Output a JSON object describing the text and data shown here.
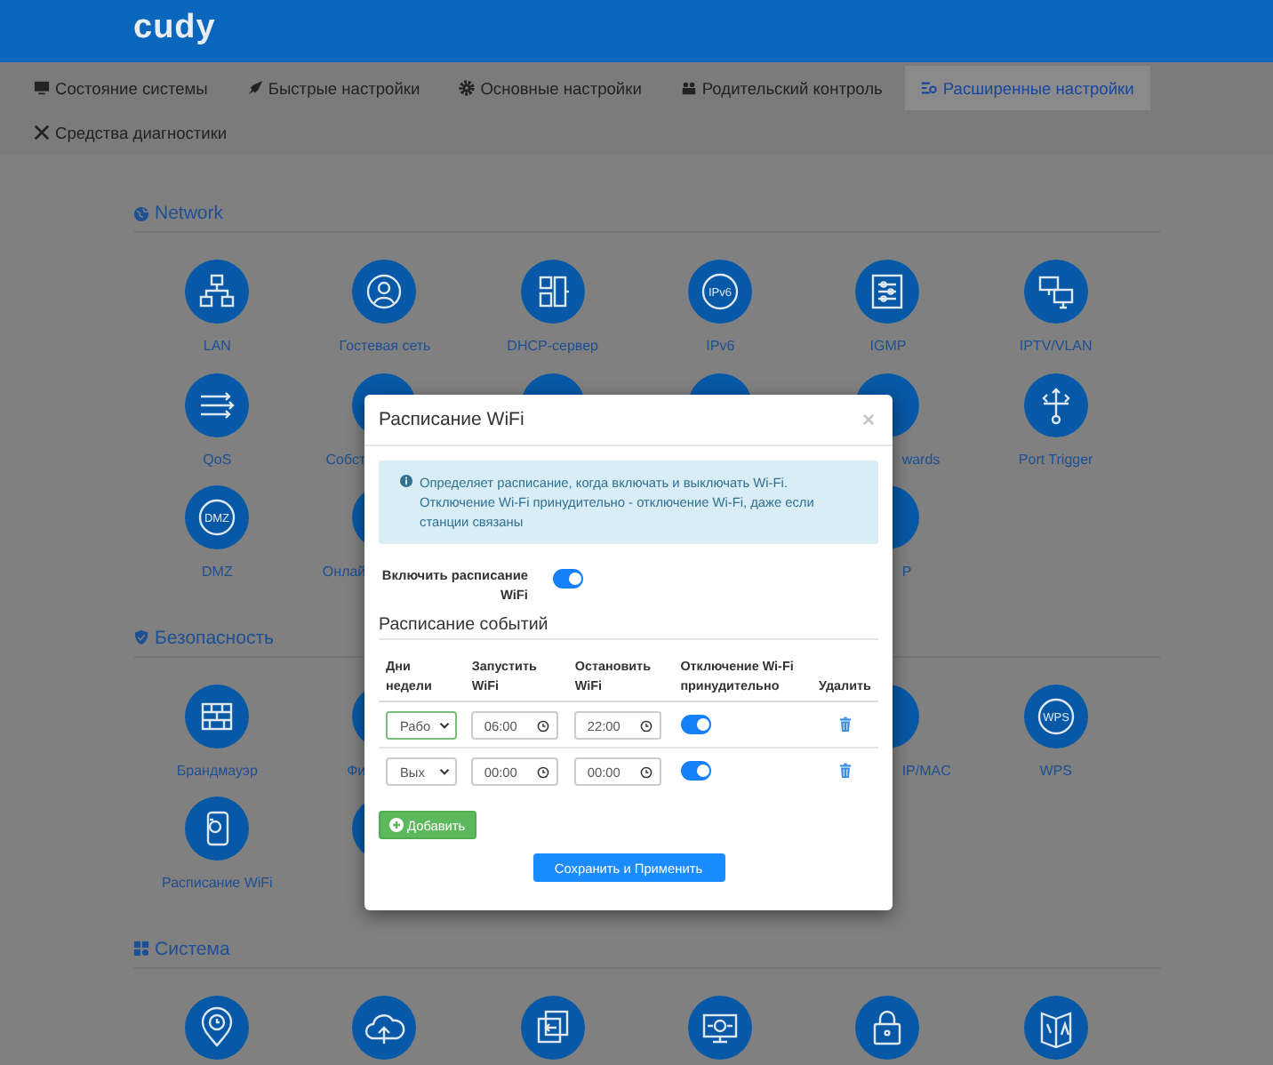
{
  "header": {
    "logo": "cudy"
  },
  "nav": [
    {
      "label": "Состояние системы",
      "selected": false
    },
    {
      "label": "Быстрые настройки",
      "selected": false
    },
    {
      "label": "Основные настройки",
      "selected": false
    },
    {
      "label": "Родительский контроль",
      "selected": false
    },
    {
      "label": "Расширенные настройки",
      "selected": true
    },
    {
      "label": "Средства диагностики",
      "selected": false
    }
  ],
  "sections": [
    {
      "title": "Network",
      "items": [
        {
          "kind": "full",
          "label": "LAN"
        },
        {
          "kind": "full",
          "label": "Гостевая сеть"
        },
        {
          "kind": "full",
          "label": "DHCP-сервер"
        },
        {
          "kind": "full",
          "label": "IPv6",
          "icon_text": "IPv6"
        },
        {
          "kind": "full",
          "label": "IGMP"
        },
        {
          "kind": "full",
          "label": "IPTV/VLAN"
        },
        {
          "kind": "full",
          "label": "QoS"
        },
        {
          "kind": "cut_right",
          "label": "Собст"
        },
        {
          "kind": "peek"
        },
        {
          "kind": "peek"
        },
        {
          "kind": "cut_left",
          "label": "wards"
        },
        {
          "kind": "full",
          "label": "Port Trigger"
        },
        {
          "kind": "full",
          "label": "DMZ",
          "icon_text": "DMZ"
        },
        {
          "kind": "cut_right",
          "label": "Онлай"
        },
        {
          "kind": "empty"
        },
        {
          "kind": "empty"
        },
        {
          "kind": "cut_left",
          "label": "P"
        },
        {
          "kind": "empty"
        }
      ]
    },
    {
      "title": "Безопасность",
      "items": [
        {
          "kind": "full",
          "label": "Брандмауэр"
        },
        {
          "kind": "cut_right",
          "label": "Фи"
        },
        {
          "kind": "empty"
        },
        {
          "kind": "empty"
        },
        {
          "kind": "cut_left",
          "label": "IP/MAC"
        },
        {
          "kind": "full",
          "label": "WPS",
          "icon_text": "WPS"
        },
        {
          "kind": "full",
          "label": "Расписание WiFi"
        },
        {
          "kind": "peek"
        }
      ]
    },
    {
      "title": "Система",
      "items": [
        {
          "kind": "peek"
        },
        {
          "kind": "peek"
        },
        {
          "kind": "peek"
        },
        {
          "kind": "peek"
        },
        {
          "kind": "peek"
        },
        {
          "kind": "peek"
        }
      ]
    }
  ],
  "dialog": {
    "title": "Расписание WiFi",
    "close": "×",
    "info": [
      "Определяет расписание, когда включать и выключать Wi-Fi.",
      "Отключение Wi-Fi принудительно - отключение Wi-Fi, даже если станции связаны"
    ],
    "enable_label": "Включить расписание WiFi",
    "enable_on": true,
    "events_title": "Расписание событий",
    "columns": [
      "Дни недели",
      "Запустить WiFi",
      "Остановить WiFi",
      "Отключение Wi-Fi принудительно",
      "Удалить"
    ],
    "rows": [
      {
        "day": "Рабо",
        "focused": true,
        "start": "06:00",
        "stop": "22:00",
        "force_off": true
      },
      {
        "day": "Вых",
        "focused": false,
        "start": "00:00",
        "stop": "00:00",
        "force_off": true
      }
    ],
    "add_button": "Добавить",
    "save_button": "Сохранить и Применить"
  }
}
